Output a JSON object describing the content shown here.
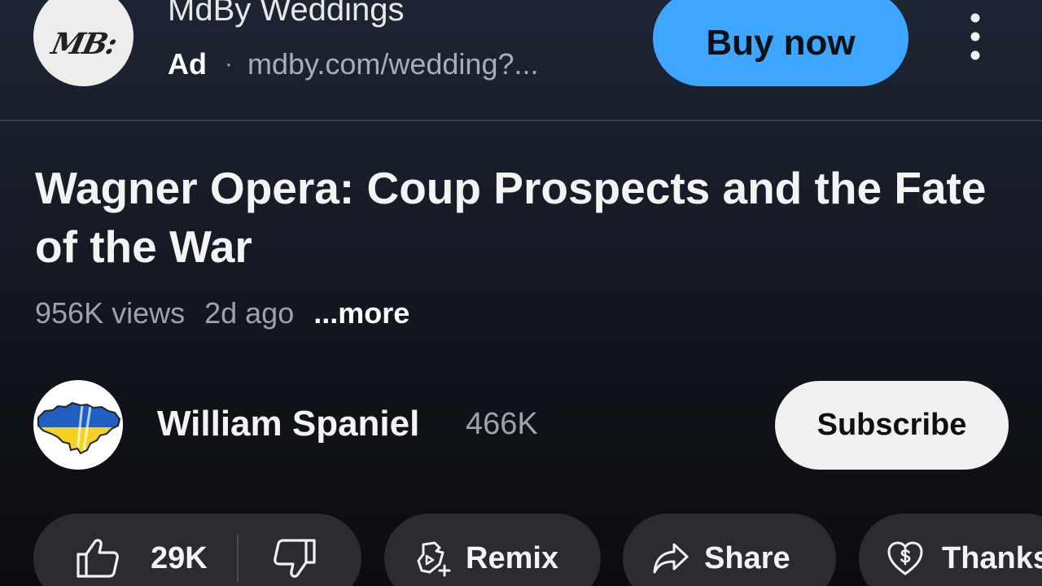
{
  "ad": {
    "logo_text": "MB:",
    "advertiser": "MdBy Weddings",
    "label": "Ad",
    "separator": "·",
    "url": "mdby.com/wedding?...",
    "cta": "Buy now",
    "cta_color": "#3ea6ff",
    "menu_icon": "more-vert-icon"
  },
  "video": {
    "title": "Wagner Opera: Coup Prospects and the Fate of the War",
    "views": "956K views",
    "age": "2d ago",
    "more": "...more"
  },
  "channel": {
    "name": "William Spaniel",
    "subscribers": "466K",
    "subscribe_label": "Subscribe",
    "avatar_icon": "ukraine-map-avatar"
  },
  "actions": {
    "likes": "29K",
    "like_icon": "thumbs-up-icon",
    "dislike_icon": "thumbs-down-icon",
    "remix_label": "Remix",
    "remix_icon": "remix-icon",
    "share_label": "Share",
    "share_icon": "share-arrow-icon",
    "thanks_label": "Thanks",
    "thanks_icon": "heart-dollar-icon"
  },
  "colors": {
    "background_top": "#1d2433",
    "background_bottom": "#0b0c10",
    "pill_background": "#2a2c31",
    "subscribe_background": "#f1f1f1",
    "secondary_text": "#9ea3ab"
  }
}
